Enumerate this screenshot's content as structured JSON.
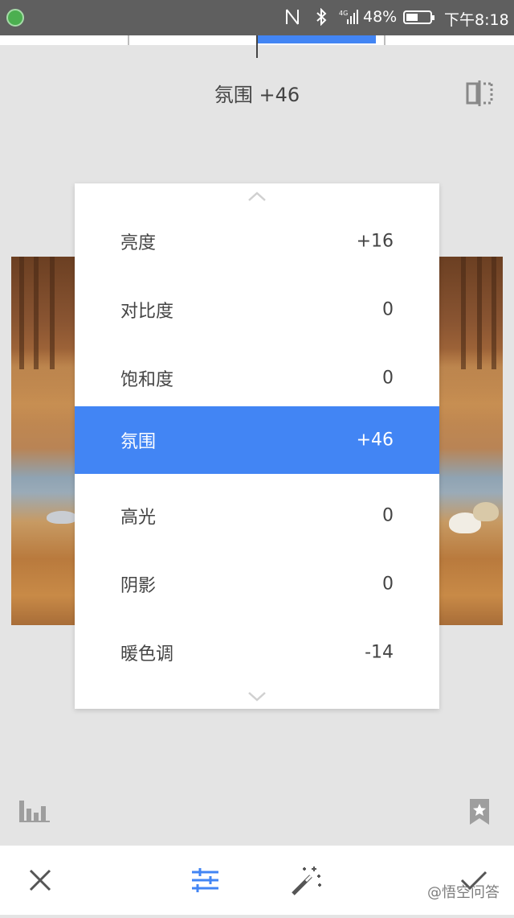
{
  "status_bar": {
    "battery_percent": "48%",
    "time": "下午8:18",
    "network_label": "4G",
    "nfc_icon": "nfc-icon",
    "bluetooth_icon": "bluetooth-icon"
  },
  "header": {
    "title": "氛围 +46",
    "compare_icon": "compare-split-icon"
  },
  "slider": {
    "value_percent": 46,
    "accent_color": "#4285f4"
  },
  "menu": {
    "items": [
      {
        "label": "亮度",
        "value": "+16"
      },
      {
        "label": "对比度",
        "value": "0"
      },
      {
        "label": "饱和度",
        "value": "0"
      },
      {
        "label": "氛围",
        "value": "+46",
        "selected": true
      },
      {
        "label": "高光",
        "value": "0"
      },
      {
        "label": "阴影",
        "value": "0"
      },
      {
        "label": "暖色调",
        "value": "-14"
      }
    ],
    "scroll_up_icon": "chevron-up-icon",
    "scroll_down_icon": "chevron-down-icon"
  },
  "tools": {
    "histogram_icon": "histogram-icon",
    "bookmark_icon": "bookmark-star-icon"
  },
  "bottom_bar": {
    "cancel_icon": "close-icon",
    "adjust_icon": "sliders-icon",
    "auto_icon": "magic-wand-icon",
    "apply_icon": "check-icon"
  },
  "watermark": "@悟空问答"
}
